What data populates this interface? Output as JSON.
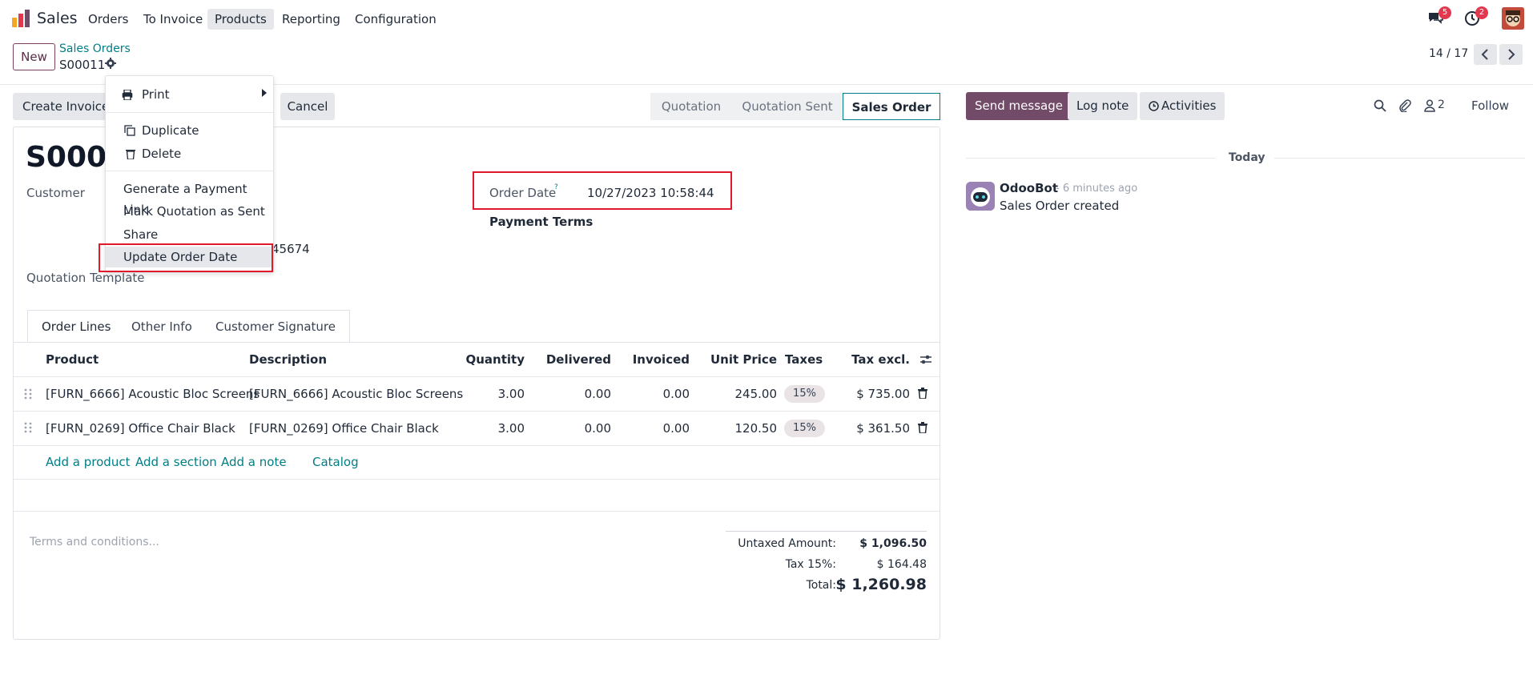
{
  "navbar": {
    "app_name": "Sales",
    "menu": [
      "Orders",
      "To Invoice",
      "Products",
      "Reporting",
      "Configuration"
    ],
    "active_menu": "Products",
    "messages_badge": "5",
    "activities_badge": "2"
  },
  "control_panel": {
    "new_label": "New",
    "breadcrumb": "Sales Orders",
    "record_name": "S00011",
    "pager": "14 / 17"
  },
  "actions": {
    "create_invoice": "Create Invoice",
    "cancel": "Cancel"
  },
  "statusbar": [
    "Quotation",
    "Quotation Sent",
    "Sales Order"
  ],
  "form": {
    "title": "S0001",
    "customer_label": "Customer",
    "partial_value": "45674",
    "quotation_template_label": "Quotation Template",
    "order_date_label": "Order Date",
    "order_date_help": "?",
    "order_date_value": "10/27/2023 10:58:44",
    "payment_terms_label": "Payment Terms"
  },
  "tabs": [
    "Order Lines",
    "Other Info",
    "Customer Signature"
  ],
  "table": {
    "headers": [
      "Product",
      "Description",
      "Quantity",
      "Delivered",
      "Invoiced",
      "Unit Price",
      "Taxes",
      "Tax excl."
    ],
    "rows": [
      {
        "product": "[FURN_6666] Acoustic Bloc Screens",
        "description": "[FURN_6666] Acoustic Bloc Screens",
        "quantity": "3.00",
        "delivered": "0.00",
        "invoiced": "0.00",
        "unit_price": "245.00",
        "tax": "15%",
        "subtotal": "$ 735.00"
      },
      {
        "product": "[FURN_0269] Office Chair Black",
        "description": "[FURN_0269] Office Chair Black",
        "quantity": "3.00",
        "delivered": "0.00",
        "invoiced": "0.00",
        "unit_price": "120.50",
        "tax": "15%",
        "subtotal": "$ 361.50"
      }
    ],
    "add_links": [
      "Add a product",
      "Add a section",
      "Add a note",
      "Catalog"
    ]
  },
  "terms_placeholder": "Terms and conditions...",
  "totals": {
    "untaxed_label": "Untaxed Amount:",
    "untaxed_value": "$ 1,096.50",
    "tax_label": "Tax 15%:",
    "tax_value": "$ 164.48",
    "total_label": "Total:",
    "total_value": "$ 1,260.98"
  },
  "dropdown": {
    "print": "Print",
    "duplicate": "Duplicate",
    "delete": "Delete",
    "generate_link": "Generate a Payment Link",
    "mark_sent": "Mark Quotation as Sent",
    "share": "Share",
    "update_date": "Update Order Date"
  },
  "chatter": {
    "send_message": "Send message",
    "log_note": "Log note",
    "activities": "Activities",
    "followers_count": "2",
    "follow": "Follow",
    "today": "Today",
    "author": "OdooBot",
    "time": "- 6 minutes ago",
    "message": "Sales Order created"
  },
  "colors": {
    "brand": "#714b67",
    "link": "#017e84",
    "highlight_border": "#e0192b",
    "badge": "#e0394f"
  }
}
